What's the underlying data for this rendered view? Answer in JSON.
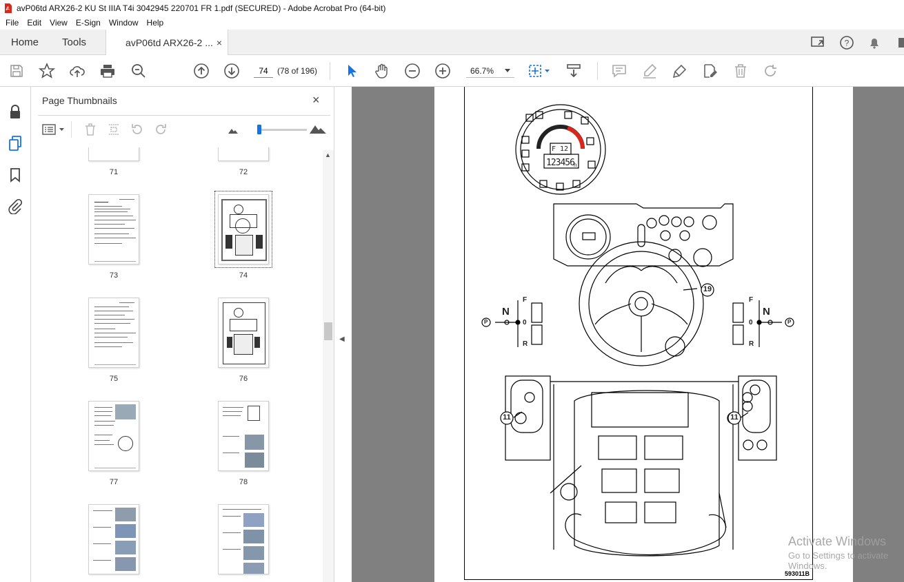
{
  "window": {
    "title": "avP06td ARX26-2 KU St IIIA T4i 3042945 220701 FR 1.pdf (SECURED) - Adobe Acrobat Pro (64-bit)"
  },
  "menu": [
    "File",
    "Edit",
    "View",
    "E-Sign",
    "Window",
    "Help"
  ],
  "tabs": {
    "home": "Home",
    "tools": "Tools",
    "document": "avP06td ARX26-2 ...",
    "document_close": "×"
  },
  "toolbar": {
    "page_number": "74",
    "page_count": "(78 of 196)",
    "zoom": "66.7%"
  },
  "panel": {
    "title": "Page Thumbnails",
    "close": "×"
  },
  "thumbnails": [
    {
      "label": "71"
    },
    {
      "label": "72"
    },
    {
      "label": "73"
    },
    {
      "label": "74",
      "selected": true
    },
    {
      "label": "75"
    },
    {
      "label": "76"
    },
    {
      "label": "77"
    },
    {
      "label": "78"
    }
  ],
  "document": {
    "callouts": [
      "19",
      "11",
      "11"
    ],
    "gear_labels": {
      "forward": "F",
      "neutral_left": "N",
      "neutral_right": "N",
      "zero": "0",
      "reverse": "R",
      "park": "P"
    },
    "hour_display": "123456",
    "hour_unit": "h",
    "gear_display": "F 12",
    "figure_code": "593011B"
  },
  "watermark": {
    "line1": "Activate Windows",
    "line2": "Go to Settings to activate Windows."
  },
  "colors": {
    "accent": "#1473e6",
    "pdf_red": "#d7281e",
    "doc_bg": "#808080"
  }
}
